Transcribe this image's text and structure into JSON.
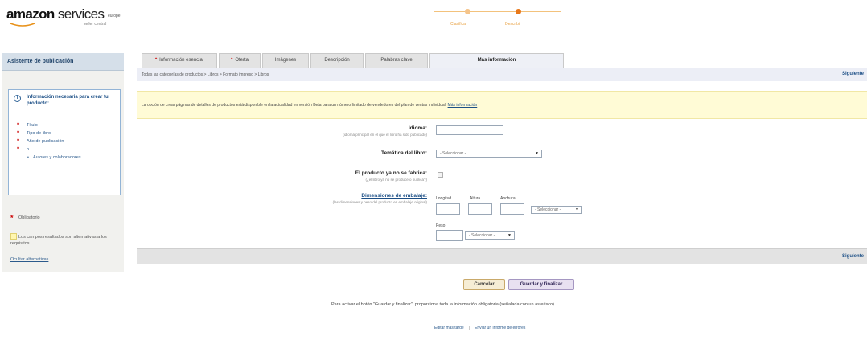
{
  "header": {
    "logo_main": "amazon",
    "logo_services": "services",
    "logo_region": "europe",
    "logo_sub": "seller central",
    "steps": [
      {
        "label": "Clasificar"
      },
      {
        "label": "Describir"
      }
    ],
    "colors": {
      "step_done": "#f5c48a",
      "step_active": "#e8781a"
    }
  },
  "sidebar": {
    "title": "Asistente de publicación",
    "info_title": "Información necesaria para crear tu producto:",
    "required_items": [
      {
        "label": "Título"
      },
      {
        "label": "Tipo de libro"
      },
      {
        "label": "Año de publicación"
      },
      {
        "label": "o"
      },
      {
        "label": "Autores y colaboradores"
      }
    ],
    "legend_required": "Obligatorio",
    "legend_alternatives": "Los campos resaltados son alternativas a los requisitos",
    "legend_link": "Ocultar alternativas"
  },
  "tabs": [
    {
      "label": "Información esencial",
      "required": true
    },
    {
      "label": "Oferta",
      "required": true
    },
    {
      "label": "Imágenes",
      "required": false
    },
    {
      "label": "Descripción",
      "required": false
    },
    {
      "label": "Palabras clave",
      "required": false
    },
    {
      "label": "Más información",
      "required": false,
      "active": true
    }
  ],
  "main": {
    "breadcrumb": "Todas las categorías de productos > Libros > Formato impreso > Libros",
    "next_label": "Siguiente",
    "notice_text": "La opción de crear páginas de detalles de productos está disponible en la actualidad en versión Beta para un número limitado de vendedores del plan de ventas Individual.",
    "notice_link": "Más información",
    "fields": {
      "language_label": "Idioma:",
      "language_hint": "(idioma principal en el que el libro ha sido publicado)",
      "theme_label": "Temática del libro:",
      "theme_value": "- Seleccionar -",
      "discontinued_label": "El producto ya no se fabrica:",
      "discontinued_hint": "(¿el libro ya no se produce o publica?)",
      "dimensions_label": "Dimensiones de embalaje:",
      "dimensions_hint": "(las dimensiones y peso del producto en embalaje original)",
      "length_label": "Longitud",
      "height_label": "Altura",
      "width_label": "Anchura",
      "unit_value": "- Seleccionar -",
      "weight_label": "Peso",
      "weight_unit_value": "- Seleccionar -"
    }
  },
  "footer": {
    "cancel_label": "Cancelar",
    "save_label": "Guardar y finalizar",
    "note": "Para activar el botón \"Guardar y finalizar\", proporciona toda la información obligatoria (señalada con un asterisco).",
    "link_edit": "Editar más tarde",
    "link_feedback": "Enviar un informe de errores"
  }
}
